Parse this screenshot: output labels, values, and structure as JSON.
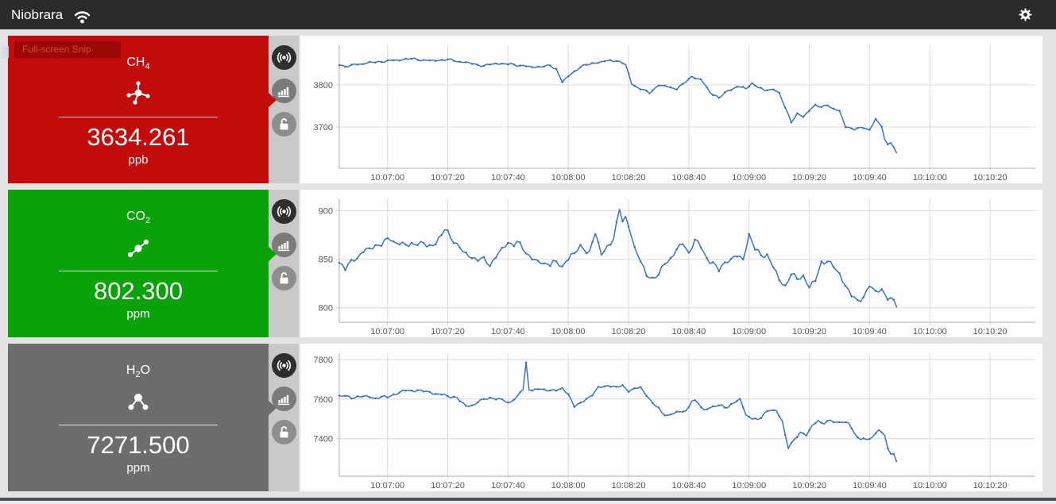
{
  "app": {
    "title": "Niobrara"
  },
  "topbar": {
    "wifi_icon": "wifi-signal",
    "settings_icon": "gear"
  },
  "artifact": {
    "snip_label": "Full-screen Snip"
  },
  "axis": {
    "x_domain": [
      -16,
      215
    ],
    "tick_seconds": [
      0,
      20,
      40,
      60,
      80,
      100,
      120,
      140,
      160,
      180,
      200
    ],
    "tick_labels": [
      "10:07:00",
      "10:07:20",
      "10:07:40",
      "10:08:00",
      "10:08:20",
      "10:08:40",
      "10:09:00",
      "10:09:20",
      "10:09:40",
      "10:10:00",
      "10:10:20"
    ]
  },
  "panels": [
    {
      "id": "ch4",
      "formula": {
        "pre": "CH",
        "sub": "4",
        "post": ""
      },
      "value": "3634.261",
      "unit": "ppb",
      "color": "#c40b0b",
      "icon": "methane-molecule",
      "chart": {
        "type": "line",
        "color": "#3b72c6",
        "ylim": [
          3602,
          3894
        ],
        "yticks": [
          3700,
          3800
        ],
        "noise": 3.2,
        "seed": 1.3,
        "points": [
          [
            -16,
            3849
          ],
          [
            -14,
            3843
          ],
          [
            -10,
            3849
          ],
          [
            -4,
            3854
          ],
          [
            2,
            3858
          ],
          [
            8,
            3862
          ],
          [
            14,
            3857
          ],
          [
            20,
            3860
          ],
          [
            26,
            3853
          ],
          [
            32,
            3845
          ],
          [
            36,
            3851
          ],
          [
            42,
            3848
          ],
          [
            48,
            3842
          ],
          [
            54,
            3845
          ],
          [
            56,
            3838
          ],
          [
            58,
            3807
          ],
          [
            61,
            3826
          ],
          [
            64,
            3843
          ],
          [
            68,
            3851
          ],
          [
            72,
            3856
          ],
          [
            76,
            3858
          ],
          [
            79,
            3848
          ],
          [
            81,
            3803
          ],
          [
            84,
            3790
          ],
          [
            87,
            3781
          ],
          [
            90,
            3800
          ],
          [
            93,
            3795
          ],
          [
            96,
            3791
          ],
          [
            98,
            3801
          ],
          [
            101,
            3820
          ],
          [
            104,
            3812
          ],
          [
            107,
            3783
          ],
          [
            110,
            3769
          ],
          [
            113,
            3786
          ],
          [
            116,
            3796
          ],
          [
            119,
            3791
          ],
          [
            121,
            3804
          ],
          [
            123,
            3795
          ],
          [
            125,
            3786
          ],
          [
            128,
            3791
          ],
          [
            130,
            3779
          ],
          [
            132,
            3746
          ],
          [
            134,
            3713
          ],
          [
            136,
            3731
          ],
          [
            138,
            3723
          ],
          [
            140,
            3741
          ],
          [
            142,
            3752
          ],
          [
            144,
            3746
          ],
          [
            146,
            3753
          ],
          [
            148,
            3743
          ],
          [
            150,
            3737
          ],
          [
            152,
            3701
          ],
          [
            155,
            3695
          ],
          [
            158,
            3698
          ],
          [
            160,
            3694
          ],
          [
            162,
            3718
          ],
          [
            164,
            3701
          ],
          [
            165,
            3669
          ],
          [
            166,
            3660
          ],
          [
            167,
            3666
          ],
          [
            168,
            3651
          ],
          [
            169,
            3636
          ]
        ]
      }
    },
    {
      "id": "co2",
      "formula": {
        "pre": "CO",
        "sub": "2",
        "post": ""
      },
      "value": "802.300",
      "unit": "ppm",
      "color": "#09a209",
      "icon": "co2-molecule",
      "chart": {
        "type": "line",
        "color": "#3b72c6",
        "ylim": [
          785,
          912
        ],
        "yticks": [
          800,
          850,
          900
        ],
        "noise": 4.2,
        "seed": 2.9,
        "points": [
          [
            -16,
            846
          ],
          [
            -14,
            840
          ],
          [
            -11,
            851
          ],
          [
            -8,
            857
          ],
          [
            -5,
            863
          ],
          [
            -2,
            866
          ],
          [
            1,
            871
          ],
          [
            4,
            866
          ],
          [
            7,
            864
          ],
          [
            10,
            868
          ],
          [
            13,
            863
          ],
          [
            16,
            867
          ],
          [
            19,
            880
          ],
          [
            22,
            870
          ],
          [
            25,
            857
          ],
          [
            28,
            852
          ],
          [
            31,
            850
          ],
          [
            34,
            845
          ],
          [
            37,
            857
          ],
          [
            40,
            866
          ],
          [
            43,
            868
          ],
          [
            46,
            856
          ],
          [
            49,
            850
          ],
          [
            52,
            843
          ],
          [
            55,
            849
          ],
          [
            58,
            841
          ],
          [
            61,
            856
          ],
          [
            64,
            861
          ],
          [
            67,
            858
          ],
          [
            69,
            878
          ],
          [
            71,
            853
          ],
          [
            73,
            864
          ],
          [
            75,
            872
          ],
          [
            76,
            885
          ],
          [
            77,
            901
          ],
          [
            78,
            890
          ],
          [
            79,
            893
          ],
          [
            80,
            885
          ],
          [
            81,
            875
          ],
          [
            82,
            862
          ],
          [
            84,
            846
          ],
          [
            86,
            836
          ],
          [
            88,
            829
          ],
          [
            90,
            834
          ],
          [
            92,
            846
          ],
          [
            94,
            852
          ],
          [
            96,
            858
          ],
          [
            98,
            868
          ],
          [
            100,
            856
          ],
          [
            102,
            870
          ],
          [
            104,
            862
          ],
          [
            107,
            848
          ],
          [
            110,
            839
          ],
          [
            113,
            850
          ],
          [
            116,
            852
          ],
          [
            118,
            851
          ],
          [
            120,
            875
          ],
          [
            122,
            861
          ],
          [
            124,
            853
          ],
          [
            126,
            856
          ],
          [
            128,
            841
          ],
          [
            130,
            829
          ],
          [
            132,
            822
          ],
          [
            134,
            836
          ],
          [
            136,
            828
          ],
          [
            138,
            834
          ],
          [
            140,
            821
          ],
          [
            142,
            828
          ],
          [
            144,
            846
          ],
          [
            146,
            850
          ],
          [
            148,
            841
          ],
          [
            150,
            835
          ],
          [
            152,
            823
          ],
          [
            154,
            813
          ],
          [
            156,
            805
          ],
          [
            158,
            813
          ],
          [
            160,
            822
          ],
          [
            162,
            816
          ],
          [
            164,
            819
          ],
          [
            166,
            811
          ],
          [
            168,
            805
          ],
          [
            169,
            802
          ]
        ]
      }
    },
    {
      "id": "h2o",
      "formula": {
        "pre": "H",
        "sub": "2",
        "post": "O"
      },
      "value": "7271.500",
      "unit": "ppm",
      "color": "#6d6d6d",
      "icon": "water-molecule",
      "chart": {
        "type": "line",
        "color": "#3b72c6",
        "ylim": [
          7210,
          7832
        ],
        "yticks": [
          7400,
          7600,
          7800
        ],
        "noise": 9,
        "seed": 4.2,
        "points": [
          [
            -16,
            7617
          ],
          [
            -12,
            7608
          ],
          [
            -8,
            7614
          ],
          [
            -4,
            7606
          ],
          [
            0,
            7611
          ],
          [
            5,
            7640
          ],
          [
            8,
            7645
          ],
          [
            12,
            7640
          ],
          [
            16,
            7628
          ],
          [
            20,
            7615
          ],
          [
            23,
            7608
          ],
          [
            26,
            7562
          ],
          [
            29,
            7575
          ],
          [
            32,
            7600
          ],
          [
            35,
            7607
          ],
          [
            38,
            7595
          ],
          [
            40,
            7582
          ],
          [
            43,
            7608
          ],
          [
            44,
            7635
          ],
          [
            45,
            7648
          ],
          [
            46,
            7780
          ],
          [
            47,
            7650
          ],
          [
            50,
            7648
          ],
          [
            54,
            7645
          ],
          [
            58,
            7648
          ],
          [
            60,
            7630
          ],
          [
            62,
            7562
          ],
          [
            64,
            7578
          ],
          [
            66,
            7600
          ],
          [
            68,
            7625
          ],
          [
            70,
            7655
          ],
          [
            73,
            7670
          ],
          [
            76,
            7660
          ],
          [
            78,
            7665
          ],
          [
            80,
            7645
          ],
          [
            82,
            7650
          ],
          [
            84,
            7658
          ],
          [
            87,
            7600
          ],
          [
            89,
            7565
          ],
          [
            91,
            7532
          ],
          [
            93,
            7518
          ],
          [
            96,
            7532
          ],
          [
            99,
            7540
          ],
          [
            101,
            7592
          ],
          [
            103,
            7580
          ],
          [
            105,
            7545
          ],
          [
            107,
            7558
          ],
          [
            109,
            7562
          ],
          [
            111,
            7568
          ],
          [
            113,
            7560
          ],
          [
            115,
            7580
          ],
          [
            117,
            7600
          ],
          [
            119,
            7522
          ],
          [
            121,
            7500
          ],
          [
            123,
            7492
          ],
          [
            125,
            7530
          ],
          [
            127,
            7545
          ],
          [
            129,
            7538
          ],
          [
            131,
            7490
          ],
          [
            133,
            7355
          ],
          [
            134,
            7372
          ],
          [
            135,
            7392
          ],
          [
            137,
            7432
          ],
          [
            139,
            7420
          ],
          [
            141,
            7465
          ],
          [
            143,
            7488
          ],
          [
            145,
            7480
          ],
          [
            147,
            7492
          ],
          [
            149,
            7478
          ],
          [
            151,
            7488
          ],
          [
            153,
            7480
          ],
          [
            155,
            7420
          ],
          [
            157,
            7400
          ],
          [
            159,
            7398
          ],
          [
            161,
            7402
          ],
          [
            163,
            7448
          ],
          [
            165,
            7420
          ],
          [
            166,
            7350
          ],
          [
            167,
            7315
          ],
          [
            168,
            7325
          ],
          [
            169,
            7282
          ]
        ]
      }
    }
  ]
}
